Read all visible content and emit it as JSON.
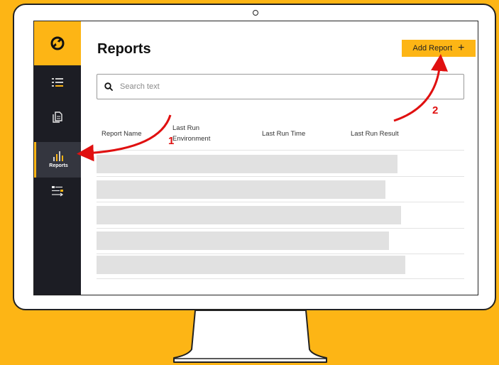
{
  "app": {
    "page_title": "Reports",
    "add_button_label": "Add Report",
    "add_button_icon": "plus-icon",
    "accent_color": "#FDB515",
    "sidebar_bg": "#1c1d24"
  },
  "sidebar": {
    "items": [
      {
        "name": "list",
        "icon": "list-icon",
        "label": ""
      },
      {
        "name": "documents",
        "icon": "document-icon",
        "label": ""
      },
      {
        "name": "reports",
        "icon": "bar-chart-icon",
        "label": "Reports",
        "active": true
      },
      {
        "name": "workflow",
        "icon": "workflow-icon",
        "label": ""
      }
    ]
  },
  "search": {
    "placeholder": "Search text"
  },
  "table": {
    "columns": [
      {
        "label": "Report Name"
      },
      {
        "label": "Last Run Environment"
      },
      {
        "label": "Last Run Time"
      },
      {
        "label": "Last Run Result"
      }
    ],
    "loading_rows": 5
  },
  "annotations": {
    "arrow_1_label": "1",
    "arrow_2_label": "2",
    "arrow_color": "#e01010"
  }
}
